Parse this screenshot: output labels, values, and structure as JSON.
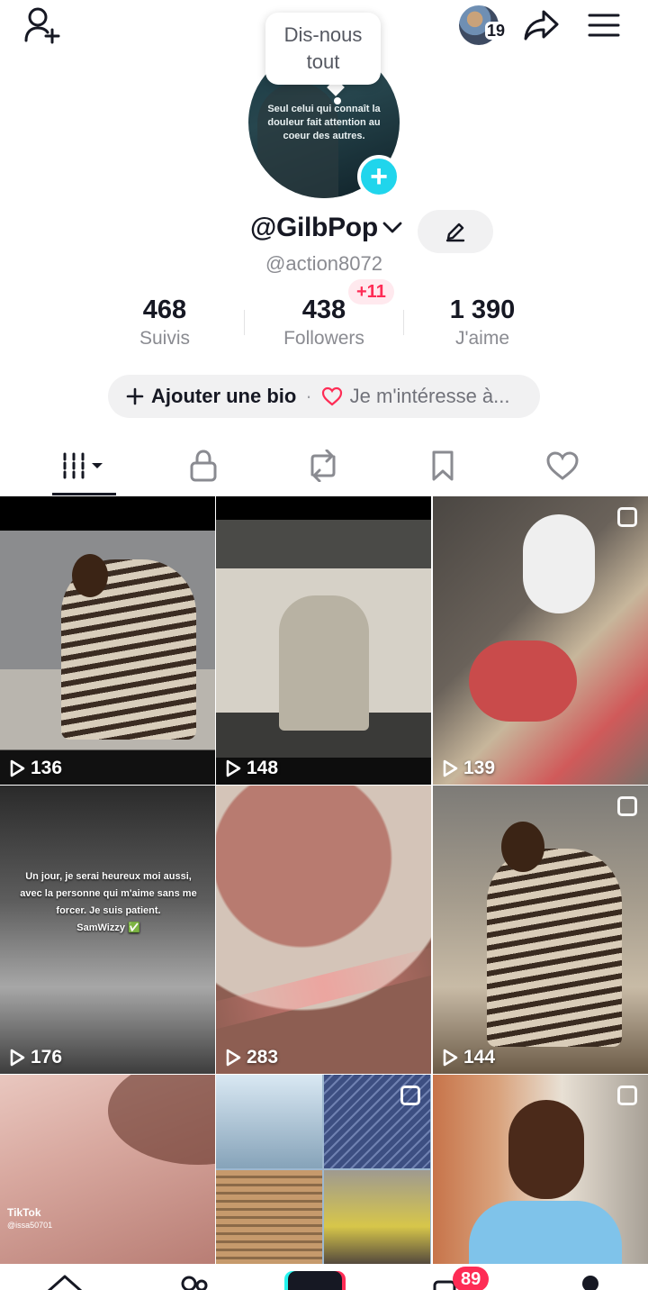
{
  "header": {
    "following_count_badge": "19"
  },
  "tooltip": {
    "text": "Dis-nous tout"
  },
  "profile": {
    "photo_quote": "Seul celui qui connaît la douleur fait attention au coeur des autres.",
    "display_name": "@GilbPop",
    "username": "@action8072",
    "new_followers_badge": "+11"
  },
  "stats": [
    {
      "value": "468",
      "label": "Suivis"
    },
    {
      "value": "438",
      "label": "Followers"
    },
    {
      "value": "1 390",
      "label": "J'aime"
    }
  ],
  "bio": {
    "add_label": "Ajouter une bio",
    "separator": "·",
    "interest_label": "Je m'intéresse à..."
  },
  "tabs": [
    {
      "icon": "videos-grid-icon",
      "selected": true
    },
    {
      "icon": "lock-icon",
      "selected": false
    },
    {
      "icon": "repost-icon",
      "selected": false
    },
    {
      "icon": "bookmark-icon",
      "selected": false
    },
    {
      "icon": "heart-icon",
      "selected": false
    }
  ],
  "videos": [
    {
      "views": "136"
    },
    {
      "views": "148"
    },
    {
      "views": "139"
    },
    {
      "views": "176"
    },
    {
      "views": "283"
    },
    {
      "views": "144"
    },
    {
      "views": ""
    },
    {
      "views": ""
    },
    {
      "views": ""
    }
  ],
  "video_text": {
    "quote": "Un jour, je serai heureux moi aussi, avec la personne qui m'aime sans me forcer. Je suis patient.",
    "signature": "SamWizzy ✅",
    "watermark_brand": "TikTok",
    "watermark_user": "@issa50701"
  },
  "bottom_nav": {
    "inbox_badge": "89"
  },
  "colors": {
    "accent_cyan": "#20d5ec",
    "accent_red": "#fe2c55",
    "text_primary": "#161823",
    "text_secondary": "#8a8b91"
  }
}
